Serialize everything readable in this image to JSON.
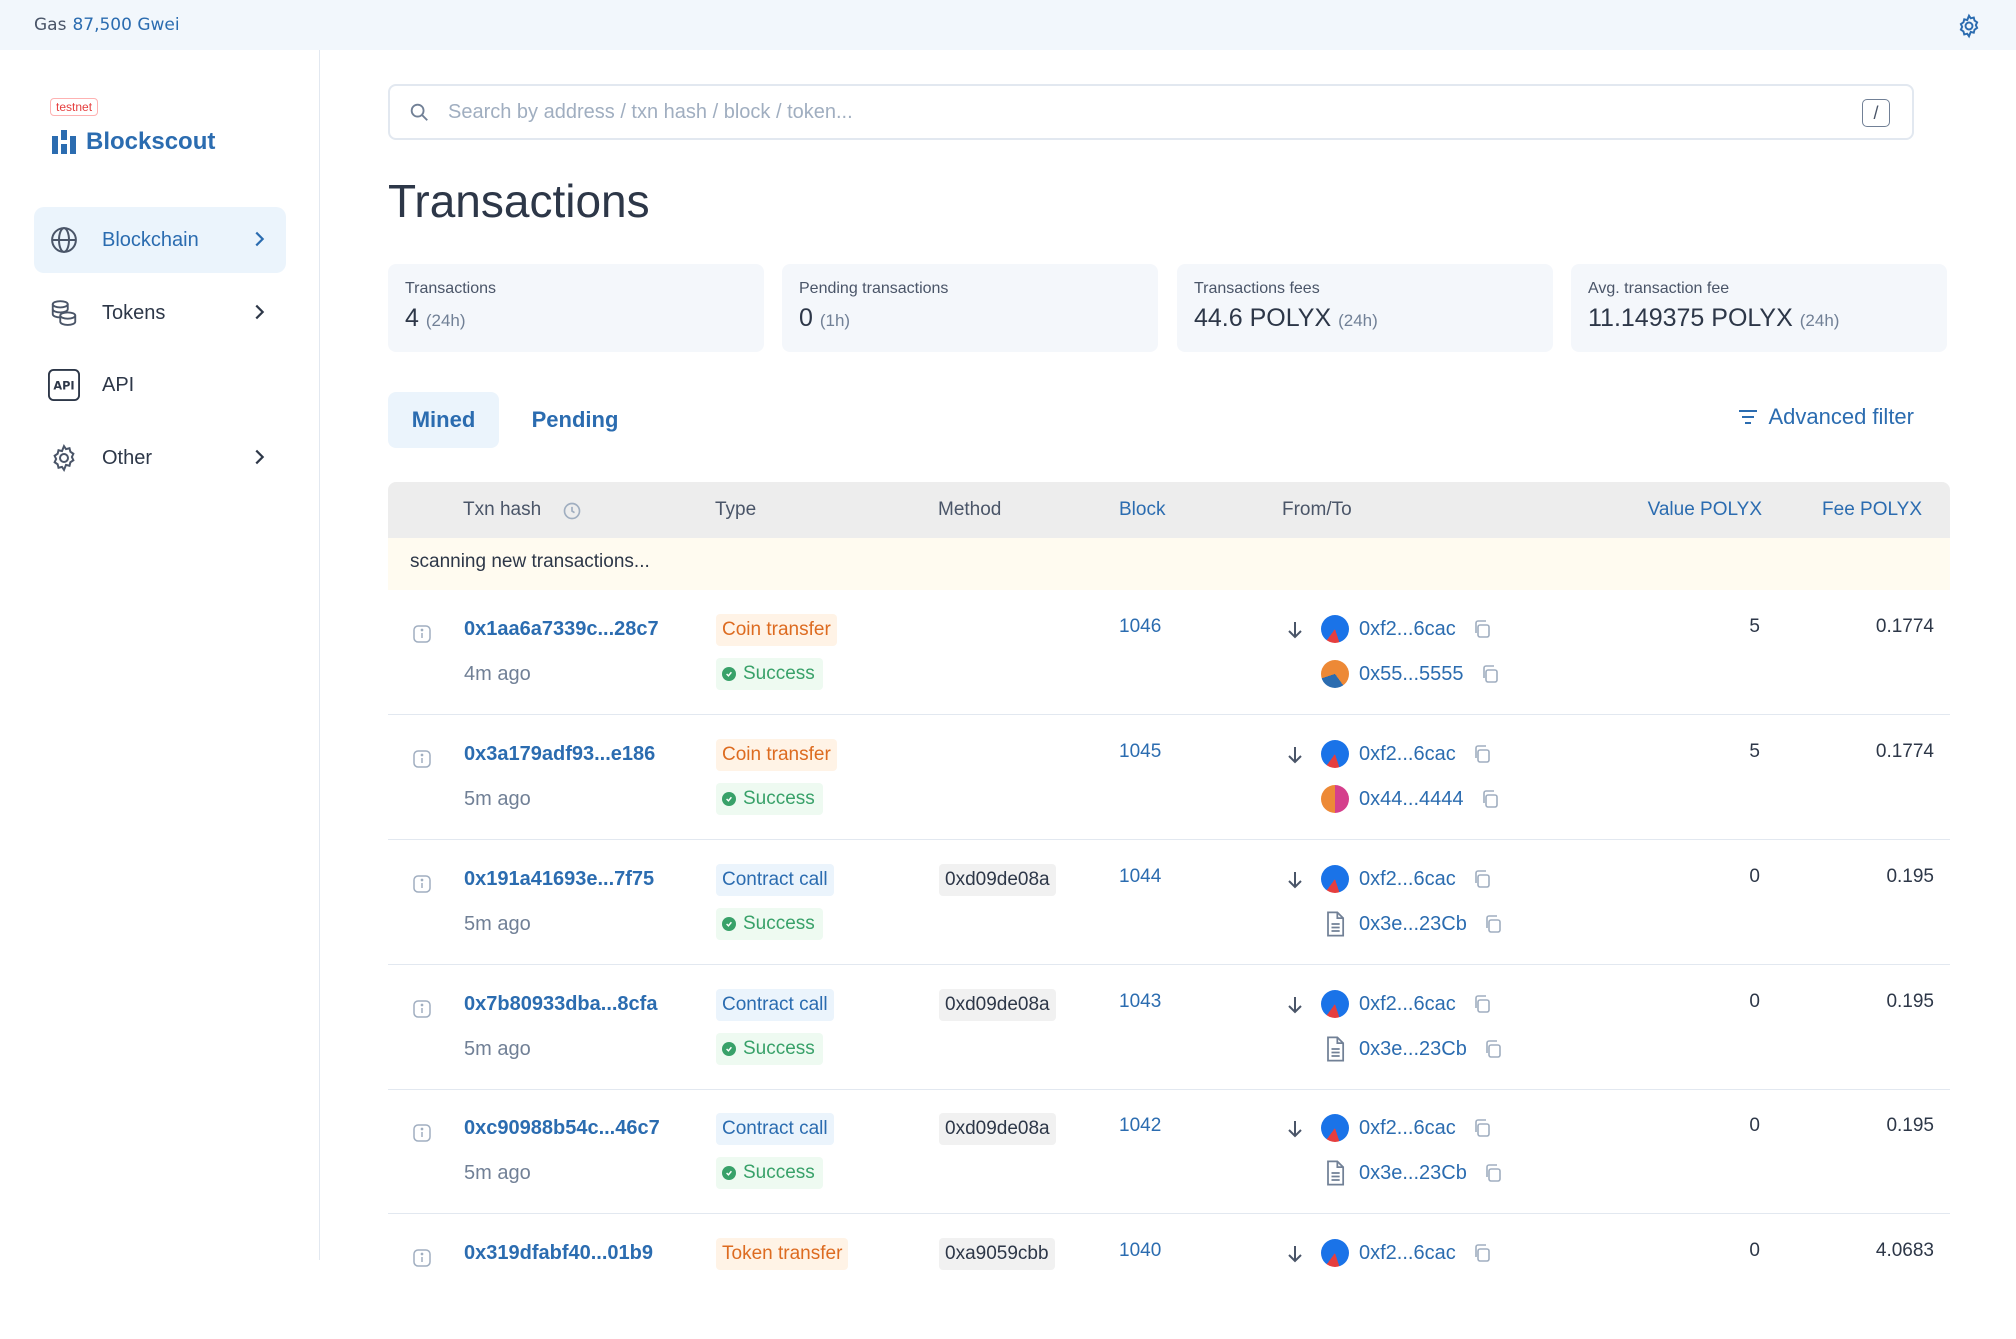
{
  "topbar": {
    "gas_label": "Gas",
    "gas_value": "87,500 Gwei"
  },
  "sidebar": {
    "badge": "testnet",
    "logo_text": "Blockscout",
    "items": [
      {
        "label": "Blockchain",
        "icon": "globe-icon"
      },
      {
        "label": "Tokens",
        "icon": "coins-icon"
      },
      {
        "label": "API",
        "icon": "api-icon"
      },
      {
        "label": "Other",
        "icon": "gear-icon"
      }
    ]
  },
  "search": {
    "placeholder": "Search by address / txn hash / block / token...",
    "shortcut": "/"
  },
  "page": {
    "title": "Transactions"
  },
  "stats": [
    {
      "label": "Transactions",
      "value": "4",
      "period": "(24h)"
    },
    {
      "label": "Pending transactions",
      "value": "0",
      "period": "(1h)"
    },
    {
      "label": "Transactions fees",
      "value": "44.6 POLYX",
      "period": "(24h)"
    },
    {
      "label": "Avg. transaction fee",
      "value": "11.149375 POLYX",
      "period": "(24h)"
    }
  ],
  "tabs": [
    {
      "label": "Mined"
    },
    {
      "label": "Pending"
    }
  ],
  "advanced_filter": "Advanced filter",
  "table": {
    "headers": {
      "txn_hash": "Txn hash",
      "type": "Type",
      "method": "Method",
      "block": "Block",
      "from_to": "From/To",
      "value": "Value POLYX",
      "fee": "Fee POLYX"
    },
    "scanning": "scanning new transactions...",
    "rows": [
      {
        "hash": "0x1aa6a7339c...28c7",
        "age": "4m ago",
        "type": "Coin transfer",
        "status": "Success",
        "method": "",
        "block": "1046",
        "from": "0xf2...6cac",
        "to": "0x55...5555",
        "value": "5",
        "fee": "0.1774"
      },
      {
        "hash": "0x3a179adf93...e186",
        "age": "5m ago",
        "type": "Coin transfer",
        "status": "Success",
        "method": "",
        "block": "1045",
        "from": "0xf2...6cac",
        "to": "0x44...4444",
        "value": "5",
        "fee": "0.1774"
      },
      {
        "hash": "0x191a41693e...7f75",
        "age": "5m ago",
        "type": "Contract call",
        "status": "Success",
        "method": "0xd09de08a",
        "block": "1044",
        "from": "0xf2...6cac",
        "to": "0x3e...23Cb",
        "value": "0",
        "fee": "0.195"
      },
      {
        "hash": "0x7b80933dba...8cfa",
        "age": "5m ago",
        "type": "Contract call",
        "status": "Success",
        "method": "0xd09de08a",
        "block": "1043",
        "from": "0xf2...6cac",
        "to": "0x3e...23Cb",
        "value": "0",
        "fee": "0.195"
      },
      {
        "hash": "0xc90988b54c...46c7",
        "age": "5m ago",
        "type": "Contract call",
        "status": "Success",
        "method": "0xd09de08a",
        "block": "1042",
        "from": "0xf2...6cac",
        "to": "0x3e...23Cb",
        "value": "0",
        "fee": "0.195"
      },
      {
        "hash": "0x319dfabf40...01b9",
        "age": "",
        "type": "Token transfer",
        "status": "",
        "method": "0xa9059cbb",
        "block": "1040",
        "from": "0xf2...6cac",
        "to": "",
        "value": "0",
        "fee": "4.0683"
      }
    ]
  },
  "colors": {
    "accent": "#2b6cb0",
    "success": "#38a169",
    "orange": "#dd6b20"
  }
}
